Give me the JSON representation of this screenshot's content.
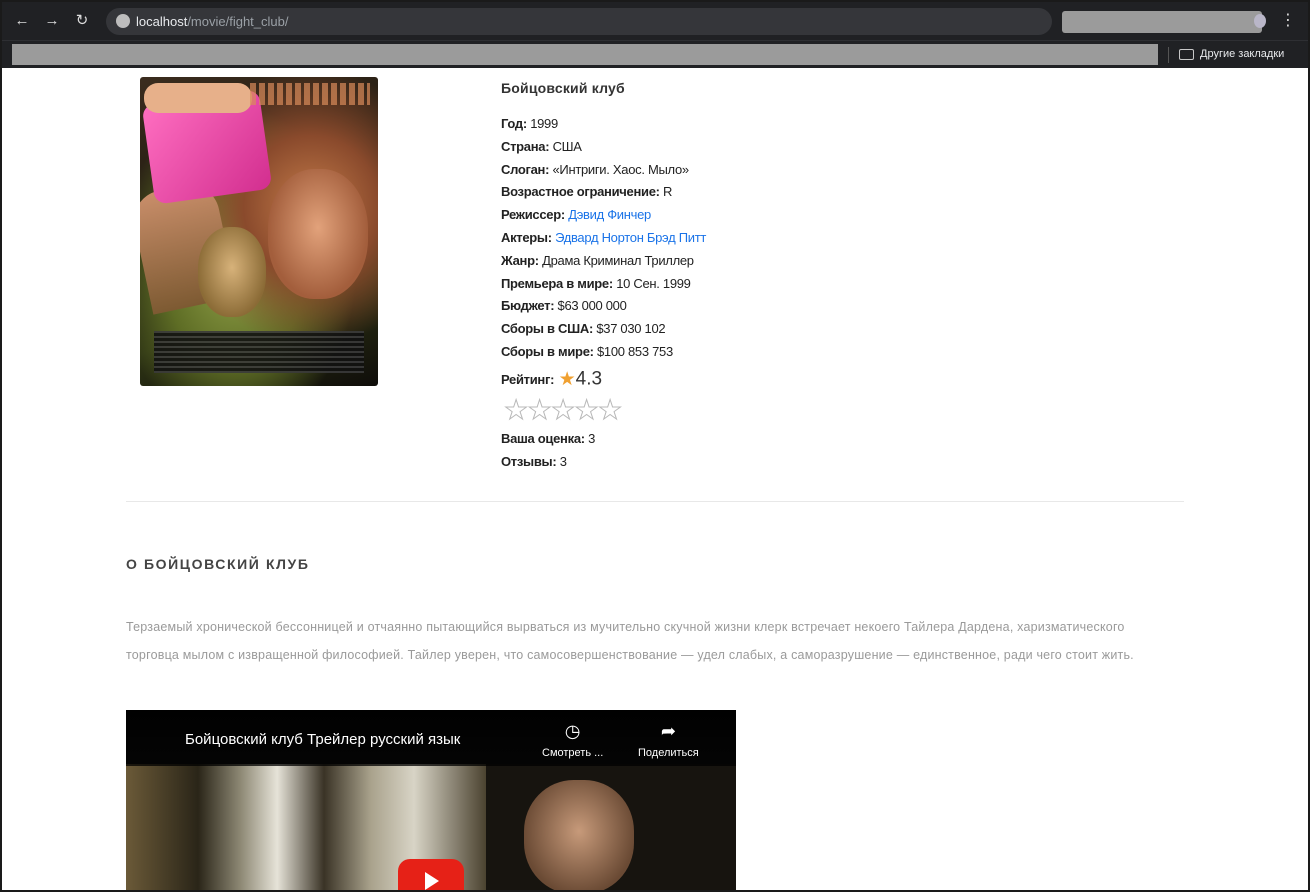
{
  "browser": {
    "url_host": "localhost",
    "url_path": "/movie/fight_club/",
    "other_bookmarks": "Другие закладки",
    "icons": {
      "back": "arrow-left-icon",
      "forward": "arrow-right-icon",
      "reload": "reload-icon",
      "site_info": "globe-icon",
      "menu": "kebab-menu-icon",
      "folder": "folder-icon"
    }
  },
  "movie": {
    "title": "Бойцовский клуб",
    "info": [
      {
        "label": "Год:",
        "value": "1999"
      },
      {
        "label": "Страна:",
        "value": "США"
      },
      {
        "label": "Слоган:",
        "value": "«Интриги. Хаос. Мыло»"
      },
      {
        "label": "Возрастное ограничение:",
        "value": "R"
      },
      {
        "label": "Режиссер:",
        "value": "Дэвид Финчер",
        "link": true
      },
      {
        "label": "Актеры:",
        "value": "Эдвард Нортон Брэд Питт",
        "link": true
      },
      {
        "label": "Жанр:",
        "value": "Драма Криминал Триллер"
      },
      {
        "label": "Премьера в мире:",
        "value": "10 Сен. 1999"
      },
      {
        "label": "Бюджет:",
        "value": "$63 000 000"
      },
      {
        "label": "Сборы в США:",
        "value": "$37 030 102"
      },
      {
        "label": "Сборы в мире:",
        "value": "$100 853 753"
      }
    ],
    "rating_label": "Рейтинг:",
    "rating_value": "4.3",
    "rating_stars_total": 5,
    "your_rating_label": "Ваша оценка:",
    "your_rating_value": "3",
    "reviews_label": "Отзывы:",
    "reviews_value": "3"
  },
  "about": {
    "heading": "О БОЙЦОВСКИЙ КЛУБ",
    "text": "Терзаемый хронической бессонницей и отчаянно пытающийся вырваться из мучительно скучной жизни клерк встречает некоего Тайлера Дардена, харизматического торговца мылом с извращенной философией. Тайлер уверен, что самосовершенствование — удел слабых, а саморазрушение — единственное, ради чего стоит жить."
  },
  "video": {
    "title": "Бойцовский клуб Трейлер русский язык",
    "watch_later": "Смотреть ...",
    "share": "Поделиться"
  },
  "colors": {
    "link": "#1a73e8",
    "star": "#f0a030",
    "youtube_red": "#e62117",
    "chrome_dark": "#202124"
  }
}
